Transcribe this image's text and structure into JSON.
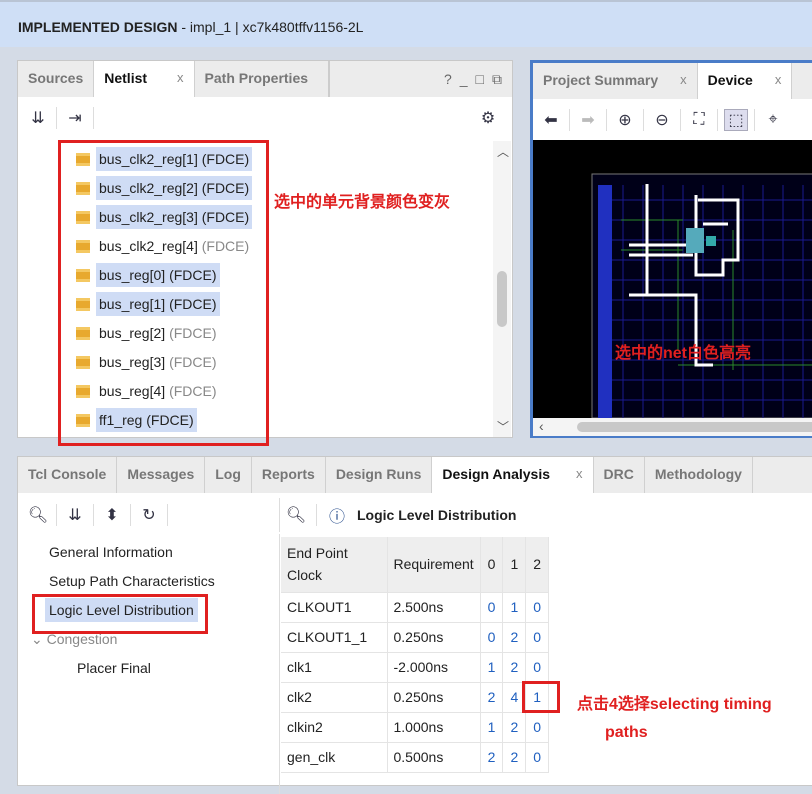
{
  "title": {
    "bold": "IMPLEMENTED DESIGN",
    "rest": " - impl_1 | xc7k480tffv1156-2L"
  },
  "netlist_panel": {
    "tabs": [
      "Sources",
      "Netlist",
      "Path Properties"
    ],
    "close": "x",
    "window_controls": [
      "?",
      "_",
      "□",
      "⧉"
    ],
    "items": [
      {
        "name": "bus_clk2_reg[1]",
        "type": "(FDCE)",
        "selected": true
      },
      {
        "name": "bus_clk2_reg[2]",
        "type": "(FDCE)",
        "selected": true
      },
      {
        "name": "bus_clk2_reg[3]",
        "type": "(FDCE)",
        "selected": true
      },
      {
        "name": "bus_clk2_reg[4]",
        "type": "(FDCE)",
        "selected": false
      },
      {
        "name": "bus_reg[0]",
        "type": "(FDCE)",
        "selected": true
      },
      {
        "name": "bus_reg[1]",
        "type": "(FDCE)",
        "selected": true
      },
      {
        "name": "bus_reg[2]",
        "type": "(FDCE)",
        "selected": false
      },
      {
        "name": "bus_reg[3]",
        "type": "(FDCE)",
        "selected": false
      },
      {
        "name": "bus_reg[4]",
        "type": "(FDCE)",
        "selected": false
      },
      {
        "name": "ff1_reg",
        "type": "(FDCE)",
        "selected": true
      }
    ],
    "annotation": "选中的单元背景颜色变灰"
  },
  "device_panel": {
    "tabs": [
      "Project Summary",
      "Device"
    ],
    "close": "x",
    "annotation": "选中的net白色高亮"
  },
  "bottom": {
    "tabs": [
      "Tcl Console",
      "Messages",
      "Log",
      "Reports",
      "Design Runs",
      "Design Analysis",
      "DRC",
      "Methodology"
    ],
    "close": "x",
    "tree": [
      "General Information",
      "Setup Path Characteristics",
      "Logic Level Distribution",
      "Congestion",
      "Placer Final"
    ],
    "report_title": "Logic Level Distribution",
    "headers": [
      "End Point Clock",
      "Requirement",
      "0",
      "1",
      "2"
    ],
    "rows": [
      [
        "CLKOUT1",
        "2.500ns",
        "0",
        "1",
        "0"
      ],
      [
        "CLKOUT1_1",
        "0.250ns",
        "0",
        "2",
        "0"
      ],
      [
        "clk1",
        "-2.000ns",
        "1",
        "2",
        "0"
      ],
      [
        "clk2",
        "0.250ns",
        "2",
        "4",
        "1"
      ],
      [
        "clkin2",
        "1.000ns",
        "1",
        "2",
        "0"
      ],
      [
        "gen_clk",
        "0.500ns",
        "2",
        "2",
        "0"
      ]
    ],
    "annotation_line1": "点击4选择selecting timing",
    "annotation_line2": "paths"
  }
}
